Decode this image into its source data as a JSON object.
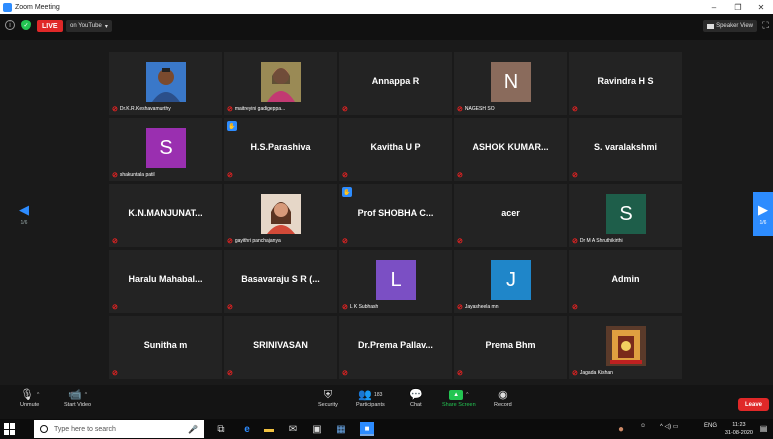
{
  "window": {
    "title": "Zoom Meeting",
    "controls": [
      "–",
      "❐",
      "✕"
    ]
  },
  "topbar": {
    "live_label": "LIVE",
    "stream_label": "on YouTube",
    "stream_caret": "▾",
    "view_label": "Speaker View",
    "info_glyph": "i",
    "shield_glyph": "✓",
    "fullscreen_glyph": "⛶"
  },
  "gallery": {
    "page_left": "1/6",
    "page_right": "1/6",
    "tiles": [
      {
        "kind": "photo",
        "label": "Dr.K.R.Keshavamurthy",
        "photo": "man"
      },
      {
        "kind": "photo",
        "label": "maitreyini gadigeppa...",
        "photo": "woman1"
      },
      {
        "kind": "name",
        "name": "Annappa R",
        "label": ""
      },
      {
        "kind": "avatar",
        "letter": "N",
        "color": "#8a6b5c",
        "label": "NAGESH SO"
      },
      {
        "kind": "name",
        "name": "Ravindra H S",
        "label": ""
      },
      {
        "kind": "avatar",
        "letter": "S",
        "color": "#9a2fb0",
        "label": "shakuntala patil"
      },
      {
        "kind": "name",
        "name": "H.S.Parashiva",
        "label": "",
        "hand": true
      },
      {
        "kind": "name",
        "name": "Kavitha U P",
        "label": ""
      },
      {
        "kind": "name",
        "name": "ASHOK KUMAR...",
        "label": ""
      },
      {
        "kind": "name",
        "name": "S. varalakshmi",
        "label": ""
      },
      {
        "kind": "name",
        "name": "K.N.MANJUNAT...",
        "label": ""
      },
      {
        "kind": "photo",
        "label": "gayithri panchajanya",
        "photo": "woman2"
      },
      {
        "kind": "name",
        "name": "Prof SHOBHA C...",
        "label": "",
        "hand": true
      },
      {
        "kind": "name",
        "name": "acer",
        "label": ""
      },
      {
        "kind": "avatar",
        "letter": "S",
        "color": "#1e5e4a",
        "label": "Dr M A Shruthikirthi"
      },
      {
        "kind": "name",
        "name": "Haralu Mahabal...",
        "label": ""
      },
      {
        "kind": "name",
        "name": "Basavaraju S R (...",
        "label": ""
      },
      {
        "kind": "avatar",
        "letter": "L",
        "color": "#7b4fc4",
        "label": "L K Subhash"
      },
      {
        "kind": "avatar",
        "letter": "J",
        "color": "#1f86c9",
        "label": "Jayasheela mn"
      },
      {
        "kind": "name",
        "name": "Admin",
        "label": ""
      },
      {
        "kind": "name",
        "name": "Sunitha m",
        "label": ""
      },
      {
        "kind": "name",
        "name": "SRINIVASAN",
        "label": ""
      },
      {
        "kind": "name",
        "name": "Dr.Prema Pallav...",
        "label": ""
      },
      {
        "kind": "name",
        "name": "Prema Bhm",
        "label": ""
      },
      {
        "kind": "photo",
        "label": "Jagada Kishan",
        "photo": "shrine"
      }
    ]
  },
  "controls": {
    "unmute": "Unmute",
    "start_video": "Start Video",
    "security": "Security",
    "participants": "Participants",
    "participants_count": "183",
    "chat": "Chat",
    "share_screen": "Share Screen",
    "record": "Record",
    "leave": "Leave",
    "caret": "^"
  },
  "taskbar": {
    "search_placeholder": "Type here to search",
    "lang": "ENG",
    "time": "11:23",
    "date": "31-08-2020",
    "tray_text": "^ ◁) ▭"
  },
  "colors": {
    "accent": "#2d8cff",
    "live": "#e02828",
    "share": "#23c552",
    "tile_bg": "#232323"
  }
}
